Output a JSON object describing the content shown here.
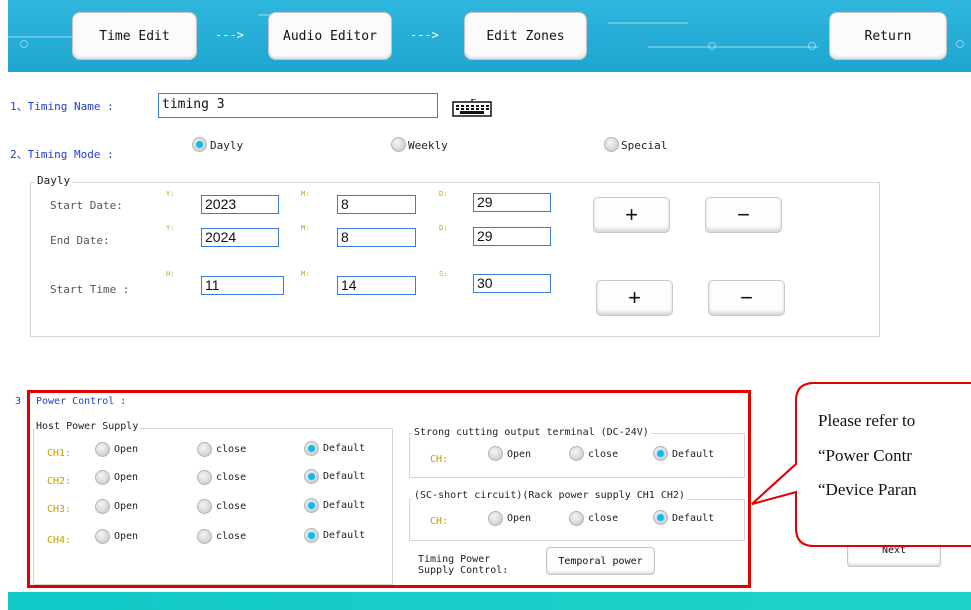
{
  "toolbar": {
    "time_edit": "Time Edit",
    "audio_editor": "Audio Editor",
    "edit_zones": "Edit Zones",
    "return": "Return",
    "arrow": "--->"
  },
  "timing_name": {
    "label": "1、Timing Name :",
    "value": "timing 3",
    "keyboard_icon": "keyboard-icon"
  },
  "timing_mode": {
    "label": "2、Timing Mode :",
    "options": [
      "Dayly",
      "Weekly",
      "Special"
    ],
    "selected": "Dayly"
  },
  "dayly": {
    "legend": "Dayly",
    "start_date_label": "Start Date:",
    "end_date_label": "End Date:",
    "start_time_label": "Start Time  :",
    "y": "Y:",
    "m": "M:",
    "d": "D:",
    "h": "H:",
    "s": "S:",
    "start_date": {
      "y": "2023",
      "m": "8",
      "d": "29"
    },
    "end_date": {
      "y": "2024",
      "m": "8",
      "d": "29"
    },
    "start_time": {
      "h": "11",
      "m": "14",
      "s": "30"
    },
    "plus": "+",
    "minus": "−"
  },
  "power": {
    "label": "Power Control :",
    "section_num": "3",
    "host_legend": "Host Power Supply",
    "channels": [
      {
        "name": "CH1:",
        "selected": "Default"
      },
      {
        "name": "CH2:",
        "selected": "Default"
      },
      {
        "name": "CH3:",
        "selected": "Default"
      },
      {
        "name": "CH4:",
        "selected": "Default"
      }
    ],
    "opt_open": "Open",
    "opt_close": "close",
    "opt_default": "Default",
    "strong_legend": "Strong cutting output terminal (DC-24V)",
    "sc_legend": "(SC-short circuit)(Rack power supply CH1 CH2)",
    "ch": "CH:",
    "timing_power_label": "Timing Power\nSupply Control:",
    "timing_power_l1": "Timing Power",
    "timing_power_l2": "Supply Control:",
    "temporal_power": "Temporal power"
  },
  "callout": {
    "line1": "Please refer to",
    "line2": "“Power Contr",
    "line3": "“Device Paran"
  },
  "next_button": "Next",
  "colors": {
    "header": "#1ea6d0",
    "footer": "#11c9c7",
    "label_blue": "#1f3fd8",
    "radio_on": "#16b8e8",
    "highlight_red": "#e20000"
  }
}
